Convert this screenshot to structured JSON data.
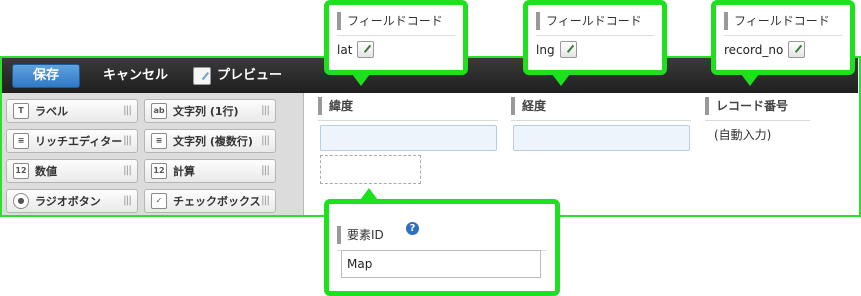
{
  "toolbar": {
    "save_label": "保存",
    "cancel_label": "キャンセル",
    "preview_label": "プレビュー"
  },
  "palette": {
    "items": [
      {
        "label": "ラベル",
        "icon": "label-icon"
      },
      {
        "label": "文字列 (1行)",
        "icon": "single-line-text-icon"
      },
      {
        "label": "リッチエディター",
        "icon": "rich-editor-icon"
      },
      {
        "label": "文字列 (複数行)",
        "icon": "multi-line-text-icon"
      },
      {
        "label": "数値",
        "icon": "number-icon"
      },
      {
        "label": "計算",
        "icon": "calc-icon"
      },
      {
        "label": "ラジオボタン",
        "icon": "radio-icon"
      },
      {
        "label": "チェックボックス",
        "icon": "checkbox-icon"
      }
    ]
  },
  "form": {
    "fields": [
      {
        "label": "緯度"
      },
      {
        "label": "経度"
      },
      {
        "label": "レコード番号",
        "value": "(自動入力)"
      }
    ]
  },
  "callouts": {
    "field_code_header": "フィールドコード",
    "lat_code": "lat",
    "lng_code": "lng",
    "record_no_code": "record_no",
    "element_id_header": "要素ID",
    "element_id_value": "Map"
  },
  "colors": {
    "highlight": "#1ee11e",
    "save_button": "#3a84cf",
    "toolbar": "#2a2a2a"
  }
}
